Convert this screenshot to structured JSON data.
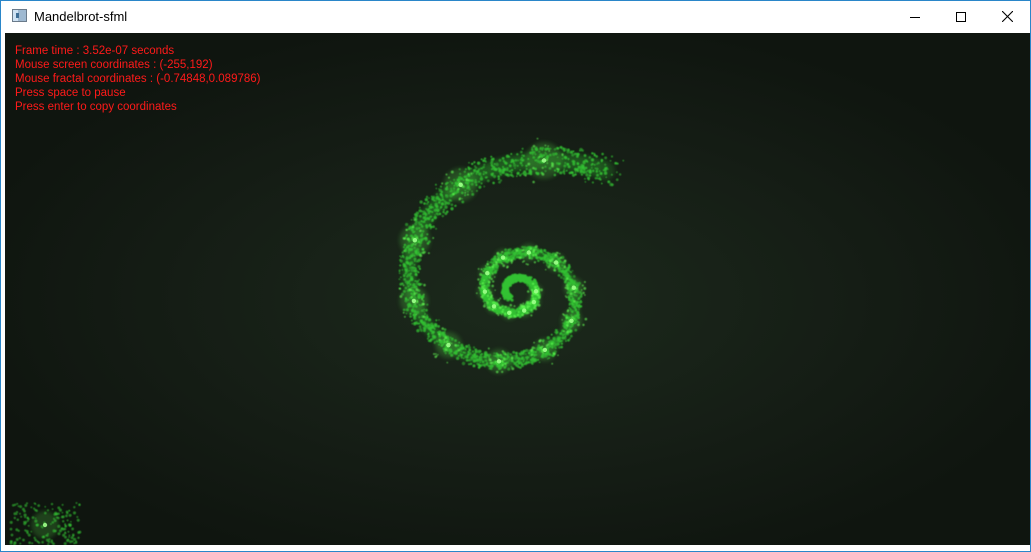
{
  "window": {
    "title": "Mandelbrot-sfml",
    "icon": "app-window-icon",
    "border_color": "#2a86c9"
  },
  "controls": {
    "minimize_icon": "minimize-icon",
    "maximize_icon": "maximize-icon",
    "close_icon": "close-icon"
  },
  "overlay": {
    "color": "#ff1a1a",
    "lines": [
      "Frame time : 3.52e-07 seconds",
      "Mouse screen coordinates : (-255,192)",
      "Mouse fractal coordinates : (-0.74848,0.089786)",
      "Press space to pause",
      "Press enter to copy coordinates"
    ]
  },
  "colors": {
    "background": "#141b14",
    "fractal": "#33c233",
    "glow": "#66ff55"
  }
}
